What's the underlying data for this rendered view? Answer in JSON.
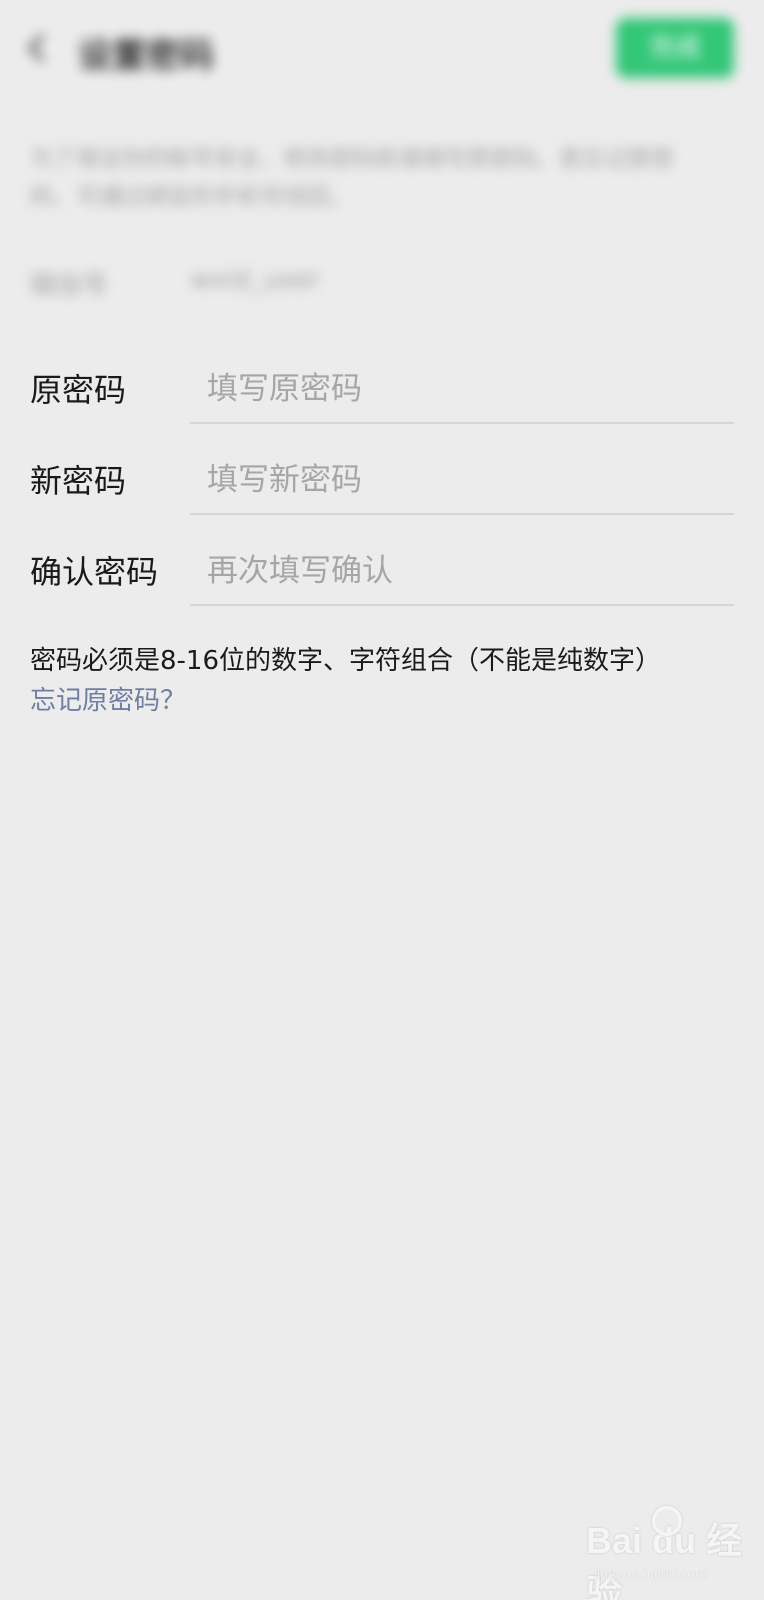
{
  "header": {
    "title": "设置密码",
    "done_label": "完成"
  },
  "description": "为了保证你的帐号安全，修改密码前请填写原密码。若忘记原密码，可通过绑定的手机号找回。",
  "account": {
    "label": "微信号",
    "value": "wxid_user"
  },
  "fields": [
    {
      "label": "原密码",
      "placeholder": "填写原密码"
    },
    {
      "label": "新密码",
      "placeholder": "填写新密码"
    },
    {
      "label": "确认密码",
      "placeholder": "再次填写确认"
    }
  ],
  "hint": "密码必须是8-16位的数字、字符组合（不能是纯数字）",
  "forgot_link": "忘记原密码？",
  "watermark": {
    "logo": "Bai du 经验",
    "url": "jingyan.baidu.com"
  },
  "colors": {
    "background": "#ececec",
    "accent_green": "#1fc36b",
    "link": "#6d7fa3",
    "placeholder": "#a6a6a6"
  }
}
